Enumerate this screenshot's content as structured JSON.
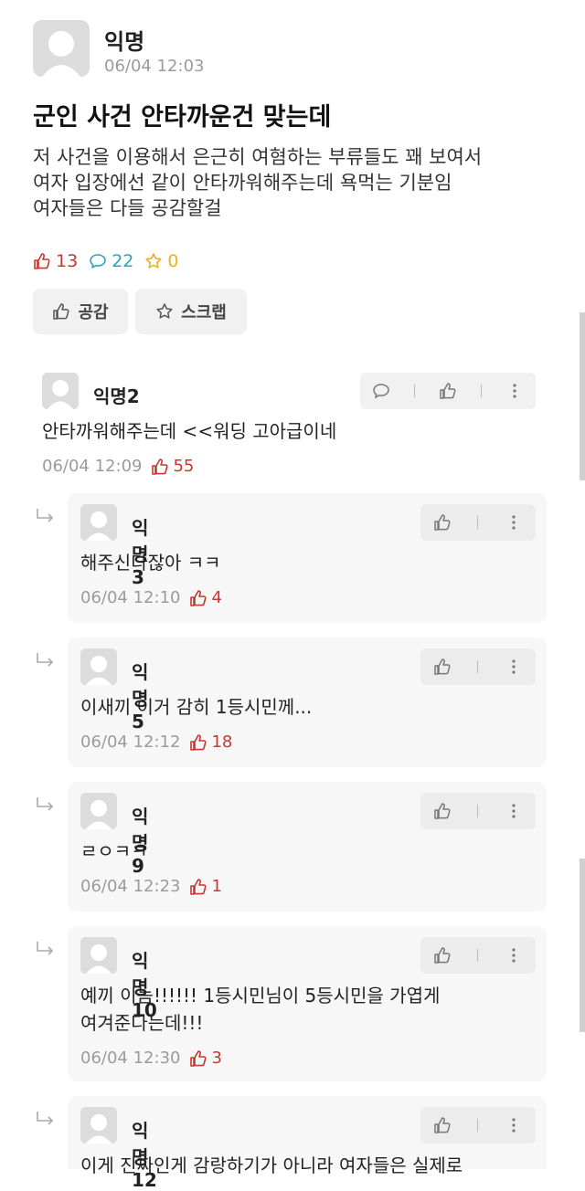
{
  "post": {
    "author": "익명",
    "time": "06/04 12:03",
    "title": "군인 사건 안타까운건 맞는데",
    "body_lines": [
      "저 사건을 이용해서 은근히 여혐하는 부류들도 꽤 보여서",
      "여자 입장에선 같이 안타까워해주는데 욕먹는 기분임",
      "여자들은 다들 공감할걸"
    ],
    "likes": "13",
    "comments": "22",
    "scraps": "0",
    "like_button": "공감",
    "scrap_button": "스크랩"
  },
  "comments": [
    {
      "author": "익명2",
      "text": "안타까워해주는데 <<워딩 고아급이네",
      "time": "06/04 12:09",
      "likes": "55"
    }
  ],
  "replies": [
    {
      "author": "익명3",
      "lines": [
        "해주신다잖아 ㅋㅋ"
      ],
      "time": "06/04 12:10",
      "likes": "4"
    },
    {
      "author": "익명5",
      "lines": [
        "이새끼 이거 감히 1등시민께..."
      ],
      "time": "06/04 12:12",
      "likes": "18"
    },
    {
      "author": "익명9",
      "lines": [
        "ㄹㅇㅋㅋ"
      ],
      "time": "06/04 12:23",
      "likes": "1"
    },
    {
      "author": "익명10",
      "lines": [
        "예끼 이놈!!!!!! 1등시민님이 5등시민을 가엽게",
        "여겨준다는데!!!"
      ],
      "time": "06/04 12:30",
      "likes": "3"
    },
    {
      "author": "익명12",
      "lines": [
        "이게 진짜인게 감랑하기가 아니라 여자들은 실제로"
      ],
      "time": "",
      "likes": ""
    }
  ],
  "colors": {
    "like": "#c8372d",
    "comment": "#2ba4b8",
    "scrap": "#e8b21e"
  }
}
